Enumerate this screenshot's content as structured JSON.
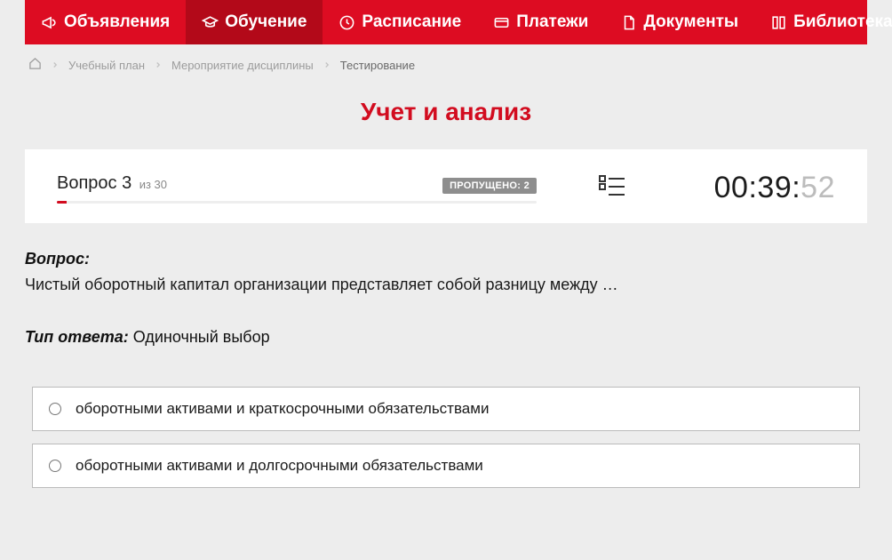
{
  "nav": {
    "items": [
      {
        "label": "Объявления",
        "icon": "megaphone-icon",
        "active": false
      },
      {
        "label": "Обучение",
        "icon": "graduation-icon",
        "active": true
      },
      {
        "label": "Расписание",
        "icon": "clock-icon",
        "active": false
      },
      {
        "label": "Платежи",
        "icon": "card-icon",
        "active": false
      },
      {
        "label": "Документы",
        "icon": "doc-icon",
        "active": false
      },
      {
        "label": "Библиотека",
        "icon": "books-icon",
        "active": false,
        "dropdown": true
      }
    ]
  },
  "breadcrumb": {
    "items": [
      {
        "label": "Учебный план"
      },
      {
        "label": "Мероприятие дисциплины"
      },
      {
        "label": "Тестирование",
        "current": true
      }
    ]
  },
  "page": {
    "title": "Учет и анализ"
  },
  "status": {
    "question_label_prefix": "Вопрос",
    "question_number": "3",
    "of_prefix": "из",
    "total": "30",
    "skipped_label": "ПРОПУЩЕНО:",
    "skipped_count": "2",
    "timer_mm": "00:39:",
    "timer_ss": "52"
  },
  "question": {
    "caption": "Вопрос:",
    "text": "Чистый оборотный капитал организации представляет собой разницу между …",
    "answer_type_label": "Тип ответа:",
    "answer_type_value": "Одиночный выбор"
  },
  "answers": [
    {
      "text": "оборотными активами и краткосрочными обязательствами"
    },
    {
      "text": "оборотными активами и долгосрочными обязательствами"
    }
  ]
}
